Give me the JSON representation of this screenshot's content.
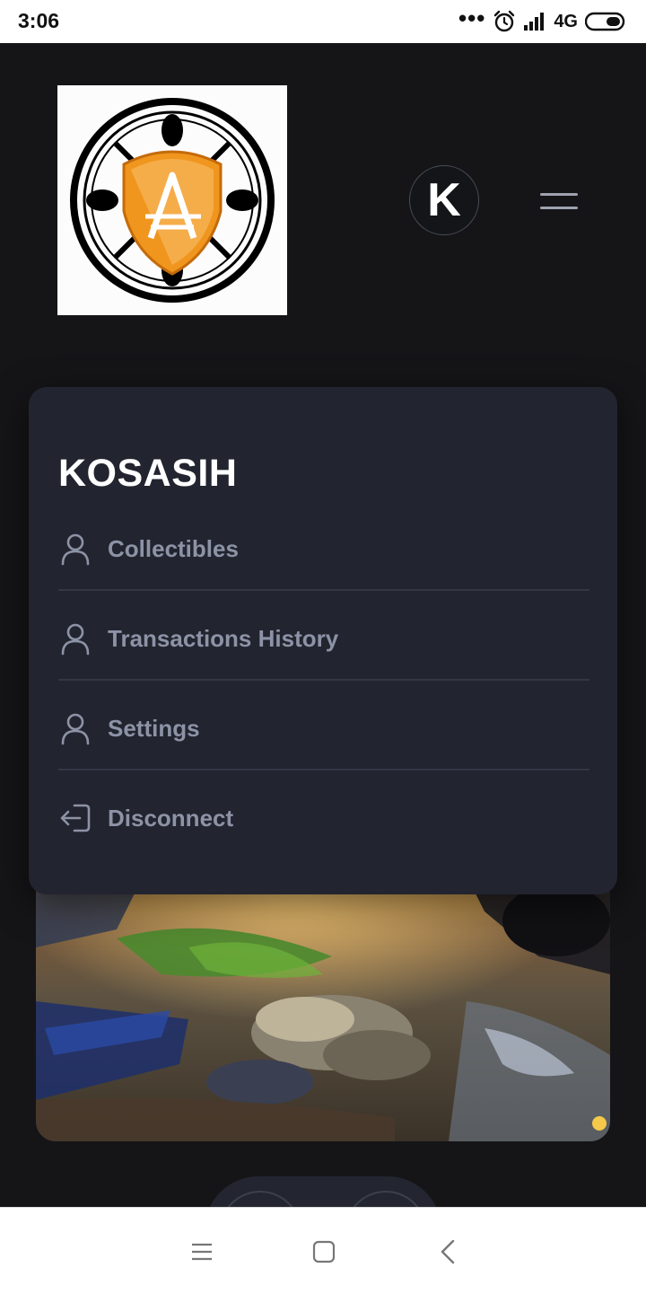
{
  "status_bar": {
    "time": "3:06",
    "dots": "•••",
    "network": "4G",
    "icons": [
      "alarm-icon",
      "signal-icon",
      "battery-icon"
    ]
  },
  "header": {
    "logo_icon": "shield-compass-logo",
    "avatar_letter": "K",
    "menu_icon": "hamburger-icon"
  },
  "menu": {
    "title": "KOSASIH",
    "items": [
      {
        "label": "Collectibles",
        "icon": "user-icon"
      },
      {
        "label": "Transactions History",
        "icon": "user-icon"
      },
      {
        "label": "Settings",
        "icon": "user-icon"
      },
      {
        "label": "Disconnect",
        "icon": "logout-icon"
      }
    ]
  },
  "colors": {
    "background": "#151518",
    "card": "#22242f",
    "item_text": "#8d93a6",
    "title_text": "#ffffff",
    "logo_orange": "#f0961e"
  },
  "nav": {
    "icons": [
      "recent-apps-icon",
      "home-icon",
      "back-icon"
    ]
  }
}
